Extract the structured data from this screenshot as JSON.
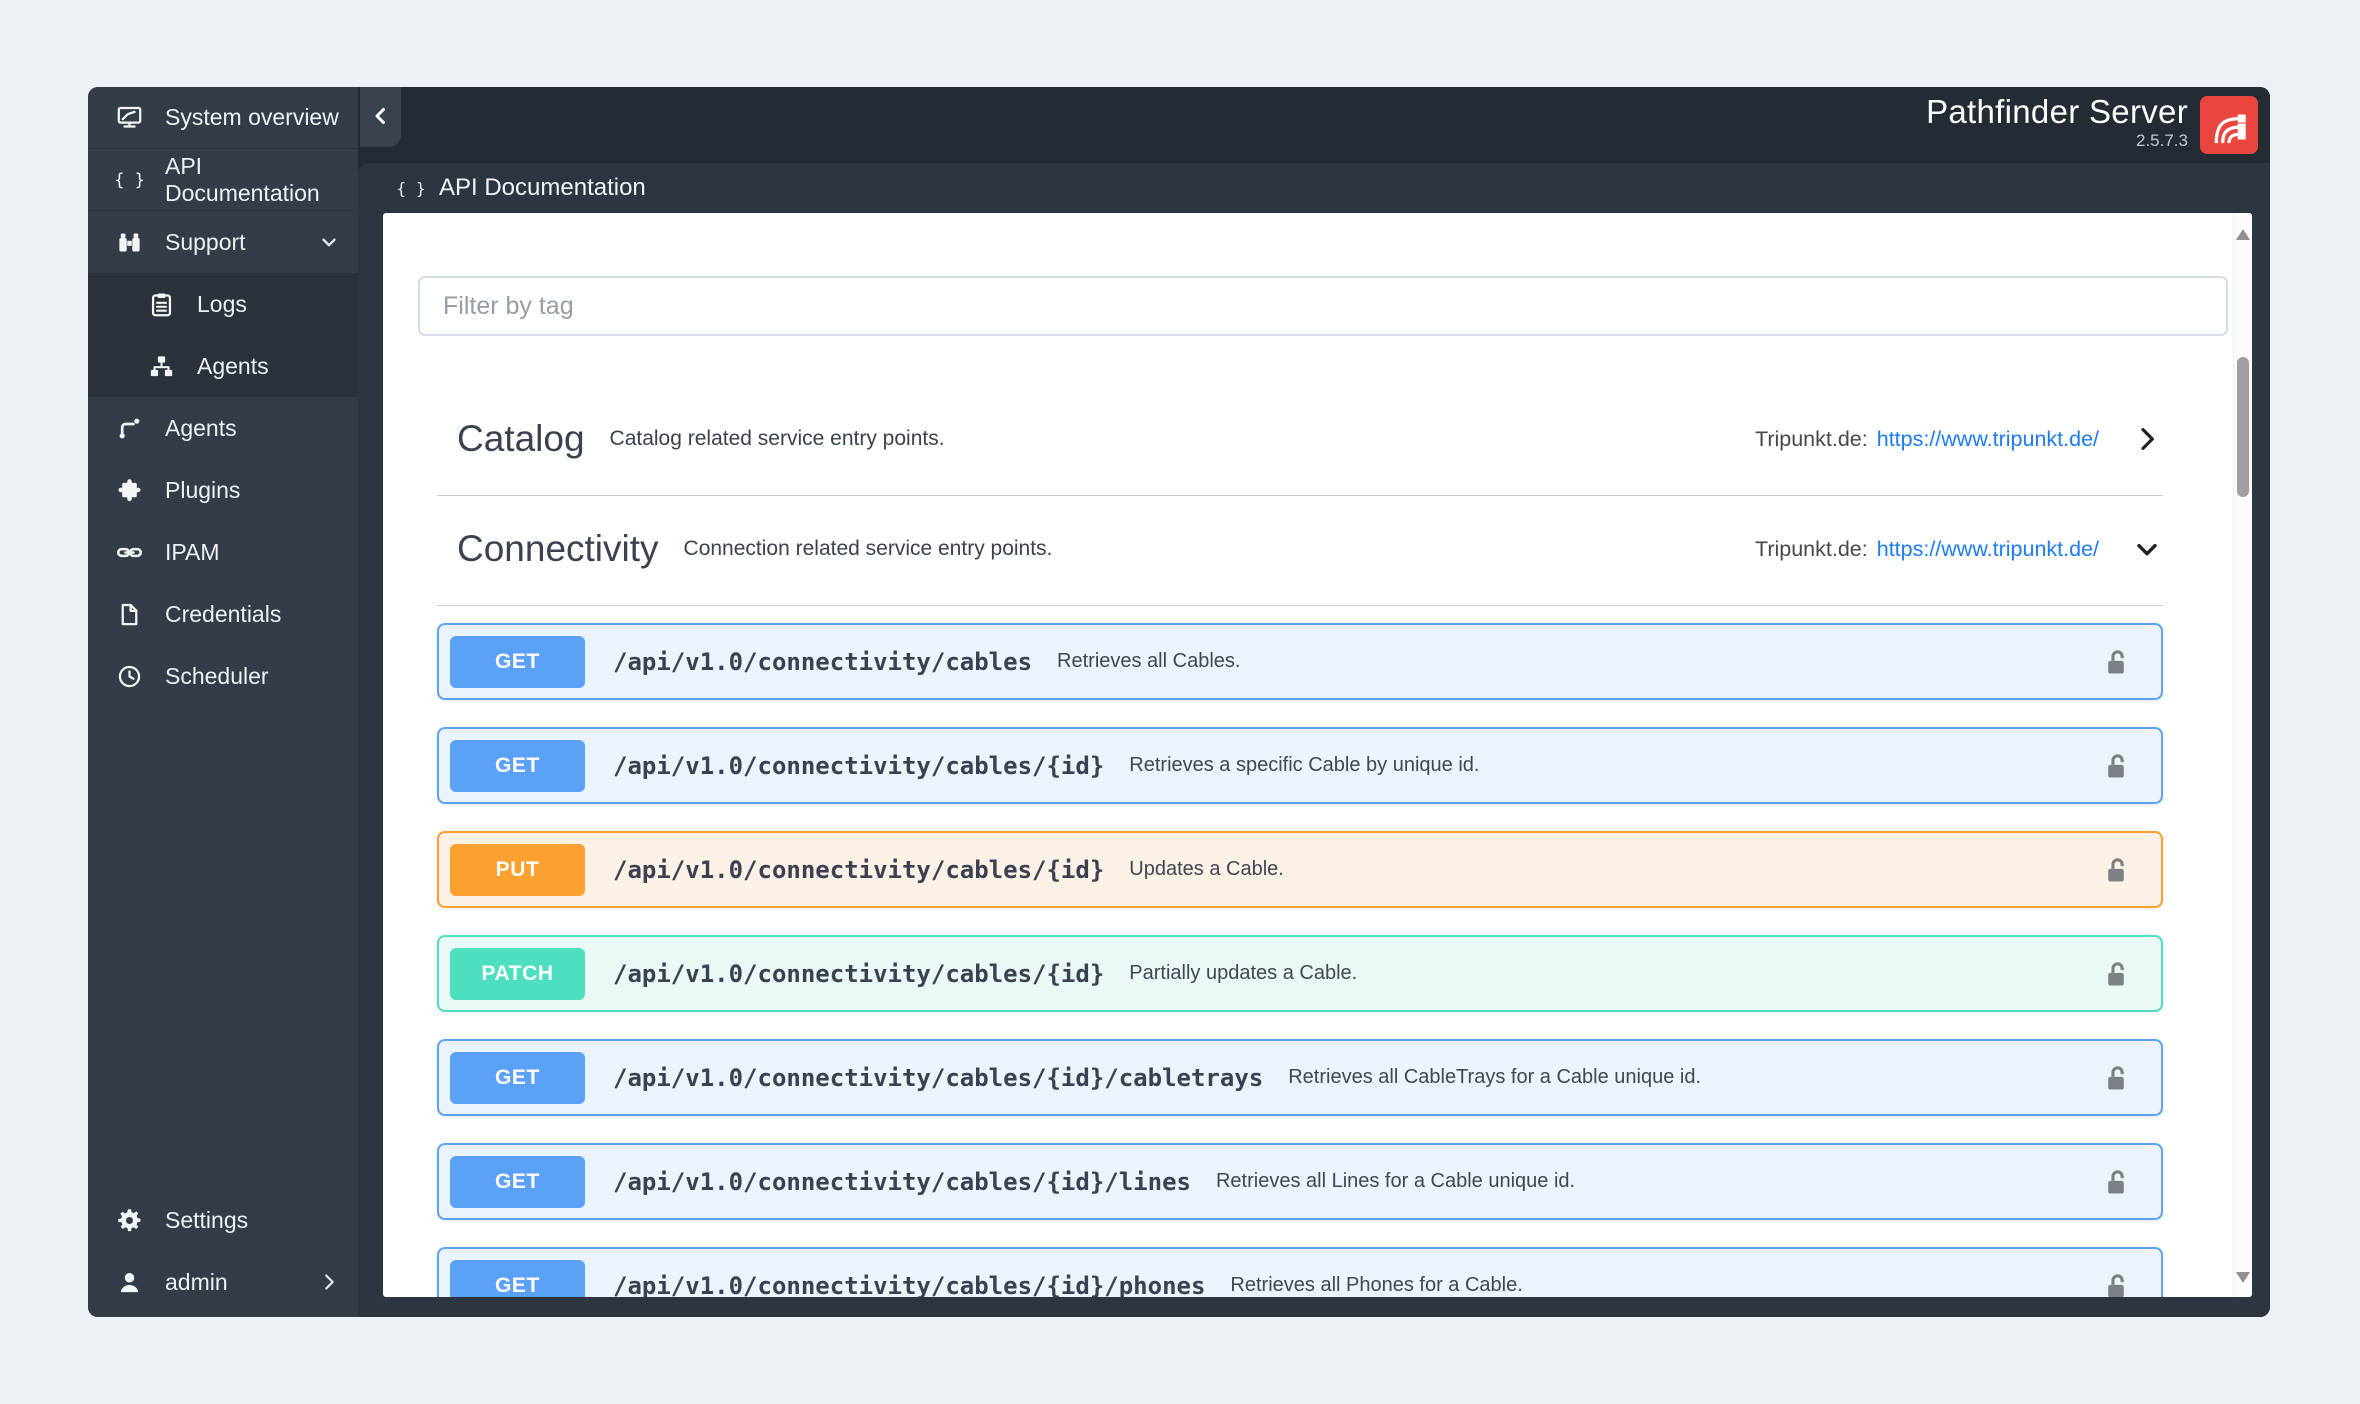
{
  "brand": {
    "title": "Pathfinder Server",
    "version": "2.5.7.3"
  },
  "page": {
    "title": "API Documentation"
  },
  "filter": {
    "placeholder": "Filter by tag"
  },
  "sidebar": {
    "items": [
      {
        "label": "System overview",
        "icon": "monitor-icon"
      },
      {
        "label": "API Documentation",
        "icon": "braces-icon"
      },
      {
        "label": "Support",
        "icon": "binoculars-icon",
        "chevron": "down"
      },
      {
        "label": "Logs",
        "icon": "clipboard-icon",
        "sub": true
      },
      {
        "label": "Agents",
        "icon": "sitemap-icon",
        "sub": true
      },
      {
        "label": "Agents",
        "icon": "route-icon"
      },
      {
        "label": "Plugins",
        "icon": "puzzle-icon"
      },
      {
        "label": "IPAM",
        "icon": "link-icon"
      },
      {
        "label": "Credentials",
        "icon": "file-icon"
      },
      {
        "label": "Scheduler",
        "icon": "clock-icon"
      }
    ],
    "bottom_items": [
      {
        "label": "Settings",
        "icon": "gear-icon"
      },
      {
        "label": "admin",
        "icon": "user-icon",
        "chevron": "right"
      }
    ]
  },
  "sections": [
    {
      "name": "Catalog",
      "description": "Catalog related service entry points.",
      "external_label": "Tripunkt.de:",
      "external_url": "https://www.tripunkt.de/",
      "state": "collapsed"
    },
    {
      "name": "Connectivity",
      "description": "Connection related service entry points.",
      "external_label": "Tripunkt.de:",
      "external_url": "https://www.tripunkt.de/",
      "state": "expanded"
    }
  ],
  "endpoints": [
    {
      "method": "GET",
      "path": "/api/v1.0/connectivity/cables",
      "description": "Retrieves all Cables."
    },
    {
      "method": "GET",
      "path": "/api/v1.0/connectivity/cables/{id}",
      "description": "Retrieves a specific Cable by unique id."
    },
    {
      "method": "PUT",
      "path": "/api/v1.0/connectivity/cables/{id}",
      "description": "Updates a Cable."
    },
    {
      "method": "PATCH",
      "path": "/api/v1.0/connectivity/cables/{id}",
      "description": "Partially updates a Cable."
    },
    {
      "method": "GET",
      "path": "/api/v1.0/connectivity/cables/{id}/cabletrays",
      "description": "Retrieves all CableTrays for a Cable unique id."
    },
    {
      "method": "GET",
      "path": "/api/v1.0/connectivity/cables/{id}/lines",
      "description": "Retrieves all Lines for a Cable unique id."
    },
    {
      "method": "GET",
      "path": "/api/v1.0/connectivity/cables/{id}/phones",
      "description": "Retrieves all Phones for a Cable."
    }
  ],
  "colors": {
    "get": "#5ba1f5",
    "get_bg": "#ebf3fc",
    "put": "#fca130",
    "put_bg": "#fbf1e5",
    "patch": "#4ddfc0",
    "patch_bg": "#e9faf5",
    "link": "#1d7bf4",
    "logo": "#e8463e"
  }
}
